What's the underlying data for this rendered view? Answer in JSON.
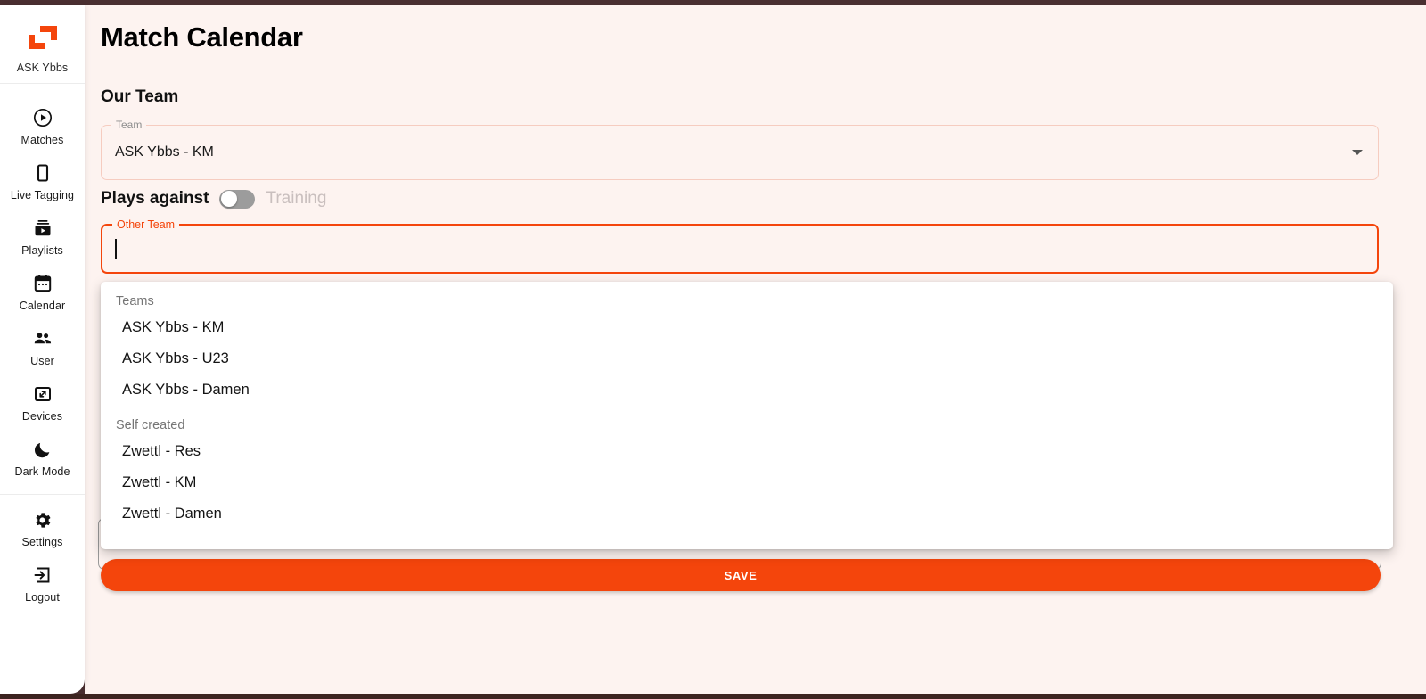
{
  "app": {
    "brand_name": "ASK Ybbs",
    "logo_icon": "corner-brackets-logo",
    "accent_color": "#f4450c",
    "background_color": "#fdf3f0",
    "rail_color": "#4a2f31"
  },
  "sidebar": {
    "items": [
      {
        "label": "Matches",
        "icon": "play-circle-icon"
      },
      {
        "label": "Live Tagging",
        "icon": "phone-icon"
      },
      {
        "label": "Playlists",
        "icon": "video-library-icon"
      },
      {
        "label": "Calendar",
        "icon": "calendar-icon"
      },
      {
        "label": "User",
        "icon": "people-icon"
      },
      {
        "label": "Devices",
        "icon": "cast-screen-icon"
      },
      {
        "label": "Dark Mode",
        "icon": "moon-icon"
      }
    ],
    "footer_items": [
      {
        "label": "Settings",
        "icon": "gear-icon"
      },
      {
        "label": "Logout",
        "icon": "logout-arrow-icon"
      }
    ]
  },
  "page": {
    "title": "Match Calendar",
    "section_our_team": "Our Team"
  },
  "team_field": {
    "legend": "Team",
    "value": "ASK Ybbs - KM",
    "arrow_icon": "chevron-down-icon"
  },
  "plays_against": {
    "label": "Plays against",
    "toggle_label": "Training",
    "toggle_state": "off"
  },
  "other_team_field": {
    "legend": "Other Team",
    "value": "",
    "placeholder": ""
  },
  "dropdown": {
    "groups": [
      {
        "label": "Teams",
        "options": [
          "ASK Ybbs - KM",
          "ASK Ybbs - U23",
          "ASK Ybbs - Damen"
        ]
      },
      {
        "label": "Self created",
        "options": [
          "Zwettl - Res",
          "Zwettl - KM",
          "Zwettl - Damen"
        ]
      }
    ]
  },
  "actions": {
    "save_label": "SAVE"
  }
}
